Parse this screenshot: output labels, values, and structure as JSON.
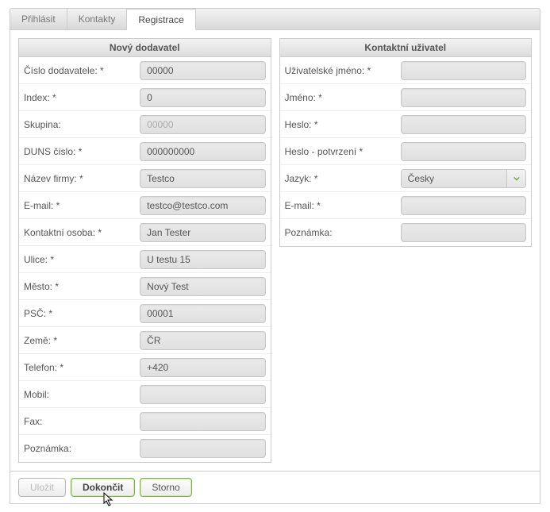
{
  "tabs": {
    "login": "Přihlásit",
    "contacts": "Kontakty",
    "register": "Registrace"
  },
  "active_tab": "register",
  "panel_left": {
    "title": "Nový dodavatel",
    "fields": {
      "supplier_no": {
        "label": "Číslo dodavatele: *",
        "value": "00000"
      },
      "index": {
        "label": "Index: *",
        "value": "0"
      },
      "group": {
        "label": "Skupina:",
        "value": "",
        "placeholder": "00000"
      },
      "duns": {
        "label": "DUNS číslo: *",
        "value": "000000000"
      },
      "company": {
        "label": "Název firmy: *",
        "value": "Testco"
      },
      "email": {
        "label": "E-mail: *",
        "value": "testco@testco.com"
      },
      "contact": {
        "label": "Kontaktní osoba: *",
        "value": "Jan Tester"
      },
      "street": {
        "label": "Ulice: *",
        "value": "U testu 15"
      },
      "city": {
        "label": "Město: *",
        "value": "Nový Test"
      },
      "zip": {
        "label": "PSČ: *",
        "value": "00001"
      },
      "country": {
        "label": "Země: *",
        "value": "ČR"
      },
      "phone": {
        "label": "Telefon: *",
        "value": "+420"
      },
      "mobile": {
        "label": "Mobil:",
        "value": ""
      },
      "fax": {
        "label": "Fax:",
        "value": ""
      },
      "note": {
        "label": "Poznámka:",
        "value": ""
      }
    }
  },
  "panel_right": {
    "title": "Kontaktní uživatel",
    "fields": {
      "username": {
        "label": "Uživatelské jméno: *",
        "value": ""
      },
      "firstname": {
        "label": "Jméno: *",
        "value": ""
      },
      "password": {
        "label": "Heslo: *",
        "value": ""
      },
      "password2": {
        "label": "Heslo - potvrzení *",
        "value": ""
      },
      "language": {
        "label": "Jazyk: *",
        "value": "Česky"
      },
      "email": {
        "label": "E-mail: *",
        "value": ""
      },
      "note": {
        "label": "Poznámka:",
        "value": ""
      }
    }
  },
  "buttons": {
    "save": "Uložit",
    "finish": "Dokončit",
    "cancel": "Storno"
  }
}
